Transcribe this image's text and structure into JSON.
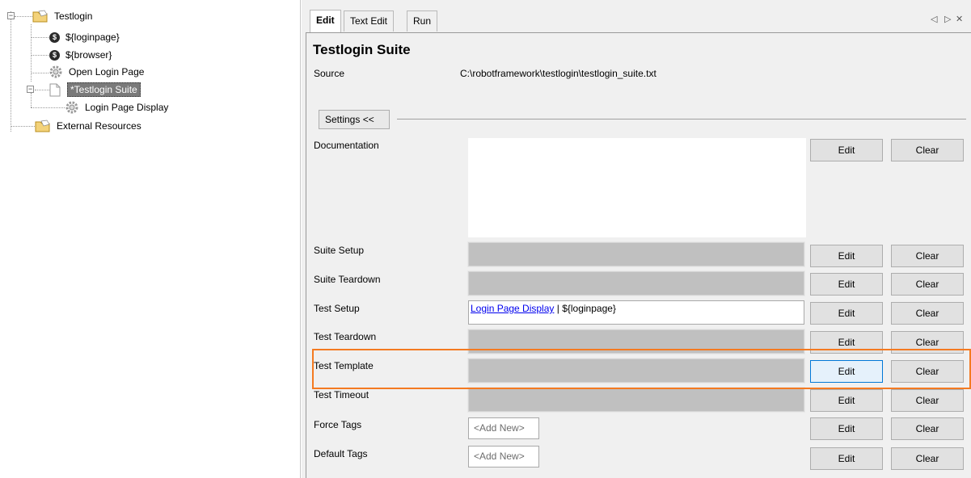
{
  "tree": {
    "root": "Testlogin",
    "items": [
      {
        "label": "${loginpage}",
        "icon": "dollar-variable-icon"
      },
      {
        "label": "${browser}",
        "icon": "dollar-variable-icon"
      },
      {
        "label": "Open Login Page",
        "icon": "gear-keyword-icon"
      },
      {
        "label": "*Testlogin Suite",
        "icon": "file-icon",
        "selected": true
      },
      {
        "label": "Login Page Display",
        "icon": "gear-keyword-icon"
      },
      {
        "label": "External Resources",
        "icon": "folder-icon"
      }
    ]
  },
  "tabs": [
    {
      "label": "Edit",
      "active": true
    },
    {
      "label": "Text Edit"
    },
    {
      "label": "Run"
    }
  ],
  "tab_nav": {
    "prev": "◁",
    "next": "▷",
    "close": "✕"
  },
  "editor": {
    "title": "Testlogin Suite",
    "source_label": "Source",
    "source_value": "C:\\robotframework\\testlogin\\testlogin_suite.txt",
    "settings_toggle": "Settings <<",
    "edit_label": "Edit",
    "clear_label": "Clear",
    "add_new_placeholder": "<Add New>",
    "settings": {
      "documentation": "Documentation",
      "suite_setup": "Suite Setup",
      "suite_teardown": "Suite Teardown",
      "test_setup": "Test Setup",
      "test_setup_keyword": "Login Page Display",
      "test_setup_args": " | ${loginpage}",
      "test_teardown": "Test Teardown",
      "test_template": "Test Template",
      "test_timeout": "Test Timeout",
      "force_tags": "Force Tags",
      "default_tags": "Default Tags"
    }
  },
  "colors": {
    "highlight_border": "#f47a21",
    "link": "#0000ee",
    "selected_bg": "#7a7a7a"
  }
}
